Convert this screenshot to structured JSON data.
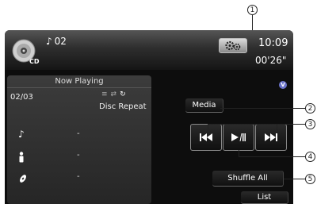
{
  "header": {
    "source_label": "CD",
    "track_number": "02",
    "clock": "10:09",
    "elapsed_time": "00'26\""
  },
  "now_playing": {
    "title": "Now Playing",
    "track_count": "02/03",
    "repeat_mode": "Disc Repeat",
    "artist": "-",
    "album": "-",
    "title_value": "-"
  },
  "badge": "V",
  "controls": {
    "media": "Media",
    "shuffle": "Shuffle All",
    "list": "List"
  },
  "callouts": [
    "1",
    "2",
    "3",
    "4",
    "5"
  ],
  "icons": [
    "cd-icon",
    "music-note-icon",
    "settings-icon",
    "shuffle-mode-icon",
    "repeat-icon",
    "artist-icon",
    "album-icon",
    "previous-track-icon",
    "play-pause-icon",
    "next-track-icon"
  ]
}
